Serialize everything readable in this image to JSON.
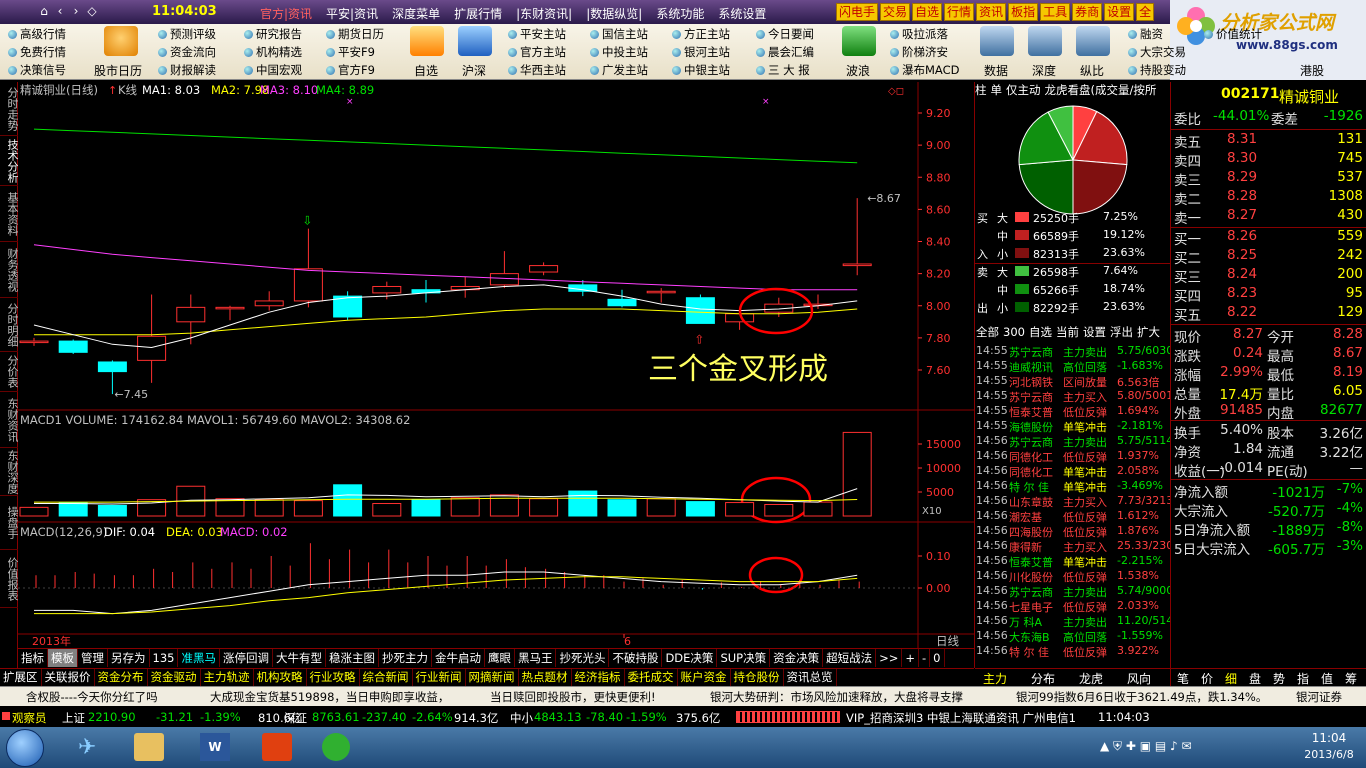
{
  "titlebar": {
    "clock": "11:04:03",
    "menu": [
      "官方|资讯",
      "平安|资讯",
      "深度菜单",
      "扩展行情",
      "|东财资讯|",
      "|数据纵览|",
      "系统功能",
      "系统设置"
    ],
    "buttons": [
      "闪电手",
      "交易",
      "自选",
      "行情",
      "资讯",
      "板指",
      "工具",
      "券商",
      "设置",
      "全"
    ]
  },
  "logo": {
    "big": "分析家公式网",
    "small": "www.88gs.com"
  },
  "toolbar": {
    "col1": [
      "高级行情",
      "免费行情",
      "决策信号"
    ],
    "cal": "股市日历",
    "col2": [
      "预测评级",
      "资金流向",
      "财报解读"
    ],
    "col3": [
      "研究报告",
      "机构精选",
      "中国宏观"
    ],
    "col4": [
      "期货日历",
      "平安F9",
      "官方F9"
    ],
    "zixuan": "自选",
    "hushen": "沪深",
    "col5": [
      "平安主站",
      "官方主站",
      "华西主站"
    ],
    "col6": [
      "国信主站",
      "中投主站",
      "广发主站"
    ],
    "col7": [
      "方正主站",
      "银河主站",
      "中银主站"
    ],
    "col8": [
      "今日要闻",
      "晨会汇编",
      "三 大 报"
    ],
    "bolang": "波浪",
    "col9": [
      "吸拉派落",
      "阶梯济安",
      "瀑布MACD"
    ],
    "tools": [
      "数据",
      "深度",
      "纵比"
    ],
    "col10": [
      "融资",
      "大宗交易",
      "持股变动"
    ],
    "col11": [
      "价值统计"
    ],
    "gangu": "港股"
  },
  "lefttabs": [
    "分时走势",
    "技术分析",
    "基本资料",
    "财务透视",
    "分时明细",
    "分价表",
    "东财资讯",
    "东财深度",
    "操盘手",
    "价值报表"
  ],
  "chart": {
    "title": "精诚铜业(日线)",
    "ktype": "K线",
    "ma": [
      "MA1: 8.03",
      "MA2: 7.98",
      "MA3: 8.10",
      "MA4: 8.89"
    ],
    "price_ticks": [
      "9.20",
      "9.00",
      "8.80",
      "8.60",
      "8.40",
      "8.20",
      "8.00",
      "7.80",
      "7.60"
    ],
    "hi_label": "8.67",
    "lo_label": "7.45",
    "annotation": "三个金叉形成",
    "vol_header": [
      "MACD1",
      "VOLUME: 174162.84",
      "MAVOL1: 56749.60",
      "MAVOL2: 34308.62"
    ],
    "vol_ticks": [
      "15000",
      "10000",
      "5000"
    ],
    "vol_unit": "X10",
    "macd_header": [
      "MACD(12,26,9)",
      "DIF: 0.04",
      "DEA: 0.03",
      "MACD: 0.02"
    ],
    "macd_ticks": [
      "0.10",
      "0.00"
    ],
    "year_label": "2013年",
    "month_label": "6",
    "period": "日线"
  },
  "colors": {
    "up": "#ff3030",
    "down": "#00ffff",
    "ma1": "#ffffff",
    "ma2": "#ffff00",
    "ma3": "#ff40ff",
    "ma4": "#00e000",
    "bg": "#000000",
    "grid": "#8b0000"
  },
  "btabs": [
    "指标",
    "模板",
    "管理",
    "另存为",
    "135",
    "准黑马",
    "涨停回调",
    "大牛有型",
    "稳涨主图",
    "抄死主力",
    "金牛启动",
    "鹰眼",
    "黑马王",
    "抄死光头",
    "不破持股",
    "DDE决策",
    "SUP决策",
    "资金决策",
    "超短战法",
    ">>",
    "+",
    "-",
    "0"
  ],
  "btabs2": [
    "扩展区",
    "关联报价",
    "资金分布",
    "资金驱动",
    "主力轨迹",
    "机构攻略",
    "行业攻略",
    "综合新闻",
    "行业新闻",
    "网摘新闻",
    "热点题材",
    "经济指标",
    "委托成交",
    "账户资金",
    "持仓股份",
    "资讯总览"
  ],
  "midpanel": {
    "tabs": [
      "柱",
      "单",
      "仅主动",
      "龙虎看盘(成交量/按所"
    ],
    "buy": [
      {
        "side": "买",
        "size": "大",
        "val": "25250手",
        "pct": "7.25%"
      },
      {
        "side": "",
        "size": "中",
        "val": "66589手",
        "pct": "19.12%"
      },
      {
        "side": "入",
        "size": "小",
        "val": "82313手",
        "pct": "23.63%"
      }
    ],
    "sell": [
      {
        "side": "卖",
        "size": "大",
        "val": "26598手",
        "pct": "7.64%"
      },
      {
        "side": "",
        "size": "中",
        "val": "65266手",
        "pct": "18.74%"
      },
      {
        "side": "出",
        "size": "小",
        "val": "82292手",
        "pct": "23.63%"
      }
    ],
    "filters": [
      "全部",
      "300",
      "自选",
      "当前",
      "设置",
      "浮出",
      "扩大"
    ],
    "flows": [
      {
        "t": "14:55",
        "n": "苏宁云商",
        "a": "主力卖出",
        "v": "5.75/6030"
      },
      {
        "t": "14:55",
        "n": "迪威视讯",
        "a": "高位回落",
        "v": "-1.683%"
      },
      {
        "t": "14:55",
        "n": "河北钢铁",
        "a": "区间放量",
        "v": "6.563倍"
      },
      {
        "t": "14:55",
        "n": "苏宁云商",
        "a": "主力买入",
        "v": "5.80/5001"
      },
      {
        "t": "14:55",
        "n": "恒泰艾普",
        "a": "低位反弹",
        "v": "1.694%"
      },
      {
        "t": "14:55",
        "n": "海德股份",
        "a": "单笔冲击",
        "v": "-2.181%"
      },
      {
        "t": "14:56",
        "n": "苏宁云商",
        "a": "主力卖出",
        "v": "5.75/5114"
      },
      {
        "t": "14:56",
        "n": "同德化工",
        "a": "低位反弹",
        "v": "1.937%"
      },
      {
        "t": "14:56",
        "n": "同德化工",
        "a": "单笔冲击",
        "v": "2.058%"
      },
      {
        "t": "14:56",
        "n": "特 尔 佳",
        "a": "单笔冲击",
        "v": "-3.469%"
      },
      {
        "t": "14:56",
        "n": "山东章鼓",
        "a": "主力买入",
        "v": "7.73/3213"
      },
      {
        "t": "14:56",
        "n": "潮宏基",
        "a": "低位反弹",
        "v": "1.612%"
      },
      {
        "t": "14:56",
        "n": "四海股份",
        "a": "低位反弹",
        "v": "1.876%"
      },
      {
        "t": "14:56",
        "n": "康得新",
        "a": "主力买入",
        "v": "25.33/230"
      },
      {
        "t": "14:56",
        "n": "恒泰艾普",
        "a": "单笔冲击",
        "v": "-2.215%"
      },
      {
        "t": "14:56",
        "n": "川化股份",
        "a": "低位反弹",
        "v": "1.538%"
      },
      {
        "t": "14:56",
        "n": "苏宁云商",
        "a": "主力卖出",
        "v": "5.74/9000"
      },
      {
        "t": "14:56",
        "n": "七星电子",
        "a": "低位反弹",
        "v": "2.033%"
      },
      {
        "t": "14:56",
        "n": "万 科A",
        "a": "主力卖出",
        "v": "11.20/514"
      },
      {
        "t": "14:56",
        "n": "大东海B",
        "a": "高位回落",
        "v": "-1.559%"
      },
      {
        "t": "14:56",
        "n": "特 尔 佳",
        "a": "低位反弹",
        "v": "3.922%"
      }
    ],
    "bottom_tabs": [
      "主力",
      "分布",
      "龙虎",
      "风向"
    ]
  },
  "quote": {
    "code": "002171",
    "name": "精诚铜业",
    "weibi_label": "委比",
    "weibi": "-44.01%",
    "weicha_label": "委差",
    "weicha": "-1926",
    "asks": [
      {
        "l": "卖五",
        "p": "8.31",
        "v": "131"
      },
      {
        "l": "卖四",
        "p": "8.30",
        "v": "745"
      },
      {
        "l": "卖三",
        "p": "8.29",
        "v": "537"
      },
      {
        "l": "卖二",
        "p": "8.28",
        "v": "1308"
      },
      {
        "l": "卖一",
        "p": "8.27",
        "v": "430"
      }
    ],
    "bids": [
      {
        "l": "买一",
        "p": "8.26",
        "v": "559"
      },
      {
        "l": "买二",
        "p": "8.25",
        "v": "242"
      },
      {
        "l": "买三",
        "p": "8.24",
        "v": "200"
      },
      {
        "l": "买四",
        "p": "8.23",
        "v": "95"
      },
      {
        "l": "买五",
        "p": "8.22",
        "v": "129"
      }
    ],
    "stats": [
      {
        "l1": "现价",
        "v1": "8.27",
        "l2": "今开",
        "v2": "8.28"
      },
      {
        "l1": "涨跌",
        "v1": "0.24",
        "l2": "最高",
        "v2": "8.67"
      },
      {
        "l1": "涨幅",
        "v1": "2.99%",
        "l2": "最低",
        "v2": "8.19"
      },
      {
        "l1": "总量",
        "v1": "17.4万",
        "l2": "量比",
        "v2": "6.05"
      },
      {
        "l1": "外盘",
        "v1": "91485",
        "l2": "内盘",
        "v2": "82677"
      }
    ],
    "stats2": [
      {
        "l1": "换手",
        "v1": "5.40%",
        "l2": "股本",
        "v2": "3.26亿"
      },
      {
        "l1": "净资",
        "v1": "1.84",
        "l2": "流通",
        "v2": "3.22亿"
      },
      {
        "l1": "收益(一)",
        "v1": "-0.014",
        "l2": "PE(动)",
        "v2": "—"
      }
    ],
    "flows": [
      {
        "l": "净流入额",
        "v": "-1021万",
        "p": "-7%"
      },
      {
        "l": "大宗流入",
        "v": "-520.7万",
        "p": "-4%"
      },
      {
        "l": "5日净流入额",
        "v": "-1889万",
        "p": "-8%"
      },
      {
        "l": "5日大宗流入",
        "v": "-605.7万",
        "p": "-3%"
      }
    ],
    "bottom_tabs": [
      "笔",
      "价",
      "细",
      "盘",
      "势",
      "指",
      "值",
      "筹"
    ]
  },
  "ticker": [
    "含权股----今天你分红了吗",
    "大成现金宝货基519898，当日申购即享收益，",
    "当日赎回即投股市，更快更便利!",
    "银河大势研判：市场风险加速释放，大盘将寻支撑",
    "银河99指数6月6日收于3621.49点，跌1.34%。",
    "银河证券"
  ],
  "status": {
    "brand": "观察员",
    "sh_label": "上证",
    "sh": "2210.90",
    "sh_chg": "-31.21",
    "sh_pct": "-1.39%",
    "sh_amt": "810.6亿",
    "sz_label": "深证",
    "sz": "8763.61",
    "sz_chg": "-237.40",
    "sz_pct": "-2.64%",
    "sz_amt": "914.3亿",
    "zx_label": "中小",
    "zx": "4843.13",
    "zx_chg": "-78.40",
    "zx_pct": "-1.59%",
    "zx_amt": "375.6亿",
    "server": "VIP_招商深圳3 中银上海联通资讯 广州电信1",
    "time": "11:04:03"
  },
  "taskbar": {
    "time": "11:04",
    "date": "2013/6/8"
  }
}
